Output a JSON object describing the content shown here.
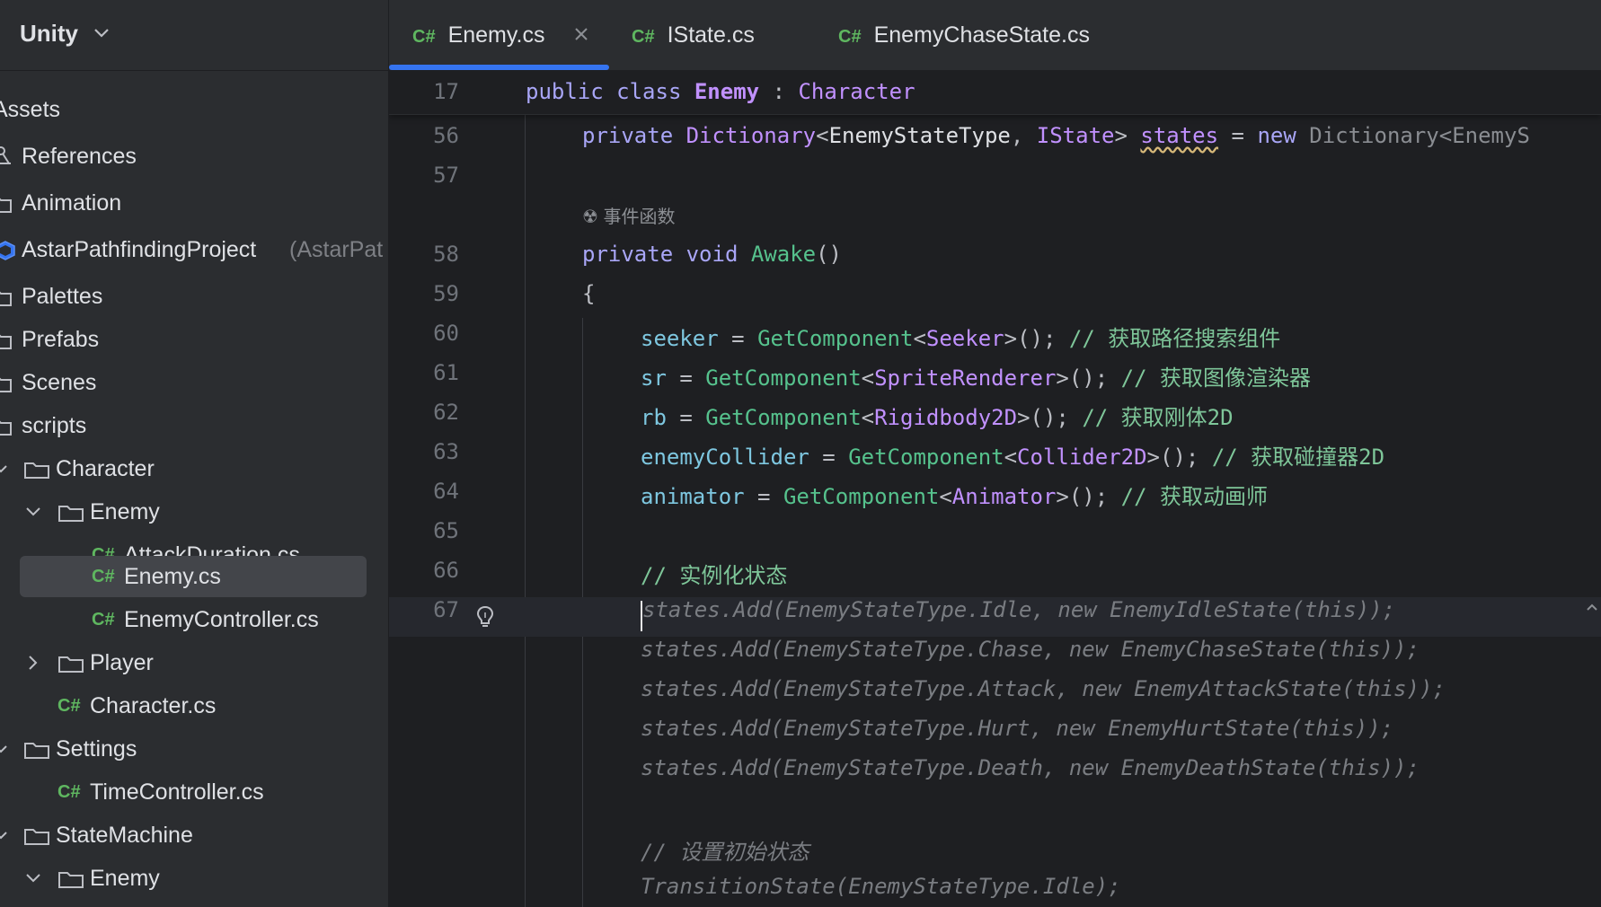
{
  "project": {
    "title": "Unity"
  },
  "tree": [
    {
      "label": "Assets",
      "kind": "root"
    },
    {
      "label": "References",
      "kind": "references"
    },
    {
      "label": "Animation",
      "kind": "folder"
    },
    {
      "label": "AstarPathfindingProject",
      "extra": "(AstarPat",
      "kind": "package"
    },
    {
      "label": "Palettes",
      "kind": "folder"
    },
    {
      "label": "Prefabs",
      "kind": "folder"
    },
    {
      "label": "Scenes",
      "kind": "folder"
    },
    {
      "label": "scripts",
      "kind": "folder"
    },
    {
      "label": "Character",
      "kind": "folder-open"
    },
    {
      "label": "Enemy",
      "kind": "folder-open"
    },
    {
      "label": "AttackDuration.cs",
      "kind": "cs",
      "badge": "C#"
    },
    {
      "label": "Enemy.cs",
      "kind": "cs",
      "badge": "C#",
      "selected": true
    },
    {
      "label": "EnemyController.cs",
      "kind": "cs",
      "badge": "C#"
    },
    {
      "label": "Player",
      "kind": "folder-closed"
    },
    {
      "label": "Character.cs",
      "kind": "cs",
      "badge": "C#"
    },
    {
      "label": "Settings",
      "kind": "folder-open"
    },
    {
      "label": "TimeController.cs",
      "kind": "cs",
      "badge": "C#"
    },
    {
      "label": "StateMachine",
      "kind": "folder-open"
    },
    {
      "label": "Enemy",
      "kind": "folder-open"
    }
  ],
  "tabs": [
    {
      "badge": "C#",
      "label": "Enemy.cs",
      "active": true
    },
    {
      "badge": "C#",
      "label": "IState.cs"
    },
    {
      "badge": "C#",
      "label": "EnemyChaseState.cs"
    }
  ],
  "editor": {
    "sticky": {
      "line": "17",
      "kw1": "public",
      "kw2": "class",
      "name": "Enemy",
      "sep": ":",
      "base": "Character"
    },
    "inlay_hint": "事件函数",
    "lines": {
      "l56": {
        "n": "56",
        "kw": "private",
        "type1": "Dictionary",
        "gen1": "EnemyStateType",
        "comma": ",",
        "gen2": "IState",
        "field": "states",
        "eq": "=",
        "new": "new",
        "rest": "Dictionary<EnemyS"
      },
      "l57": {
        "n": "57"
      },
      "l58": {
        "n": "58",
        "kw": "private",
        "kw2": "void",
        "meth": "Awake",
        "parens": "()"
      },
      "l59": {
        "n": "59",
        "text": "{"
      },
      "l60": {
        "n": "60",
        "field": "seeker",
        "eq": " = ",
        "meth": "GetComponent",
        "type": "Seeker",
        "tail": "();",
        "comment": "// 获取路径搜索组件"
      },
      "l61": {
        "n": "61",
        "field": "sr",
        "eq": " = ",
        "meth": "GetComponent",
        "type": "SpriteRenderer",
        "tail": "();",
        "comment": "// 获取图像渲染器"
      },
      "l62": {
        "n": "62",
        "field": "rb",
        "eq": " = ",
        "meth": "GetComponent",
        "type": "Rigidbody2D",
        "tail": "();",
        "comment": "// 获取刚体2D"
      },
      "l63": {
        "n": "63",
        "field": "enemyCollider",
        "eq": " = ",
        "meth": "GetComponent",
        "type": "Collider2D",
        "tail": "();",
        "comment": "// 获取碰撞器2D"
      },
      "l64": {
        "n": "64",
        "field": "animator",
        "eq": " = ",
        "meth": "GetComponent",
        "type": "Animator",
        "tail": "();",
        "comment": "// 获取动画师"
      },
      "l65": {
        "n": "65"
      },
      "l66": {
        "n": "66",
        "comment": "// 实例化状态"
      },
      "l67": {
        "n": "67",
        "ghost": "states.Add(EnemyStateType.Idle, new EnemyIdleState(this));"
      }
    },
    "suggestion": [
      "states.Add(EnemyStateType.Chase, new EnemyChaseState(this));",
      "states.Add(EnemyStateType.Attack, new EnemyAttackState(this));",
      "states.Add(EnemyStateType.Hurt, new EnemyHurtState(this));",
      "states.Add(EnemyStateType.Death, new EnemyDeathState(this));",
      "",
      "// 设置初始状态",
      "TransitionState(EnemyStateType.Idle);"
    ]
  },
  "colors": {
    "background": "#1e1f22",
    "sidebar": "#2b2d30",
    "accent": "#3574f0",
    "csharp_badge": "#5fb760"
  }
}
